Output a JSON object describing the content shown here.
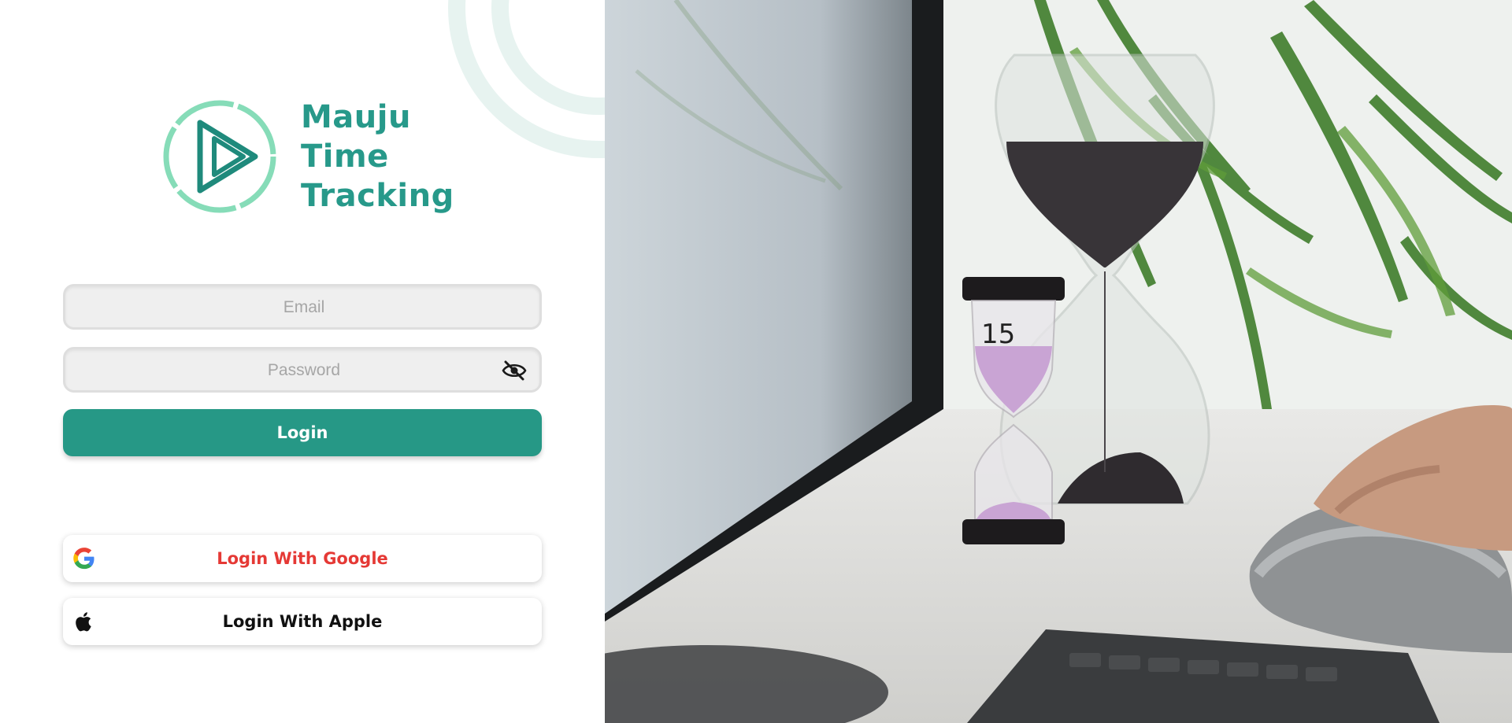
{
  "brand": {
    "name_lines": [
      "Mauju",
      "Time",
      "Tracking"
    ],
    "color": "#27998a",
    "logo_icon": "play-triangle-circle-logo"
  },
  "form": {
    "email_placeholder": "Email",
    "email_value": "",
    "password_placeholder": "Password",
    "password_value": "",
    "password_toggle_icon": "eye-slash-icon",
    "login_label": "Login",
    "login_color": "#269886"
  },
  "social": {
    "google_label": "Login With Google",
    "google_color": "#e53935",
    "google_icon": "google-icon",
    "apple_label": "Login With Apple",
    "apple_icon": "apple-icon"
  },
  "hero": {
    "image_icon": "hourglass-desk-photo"
  }
}
